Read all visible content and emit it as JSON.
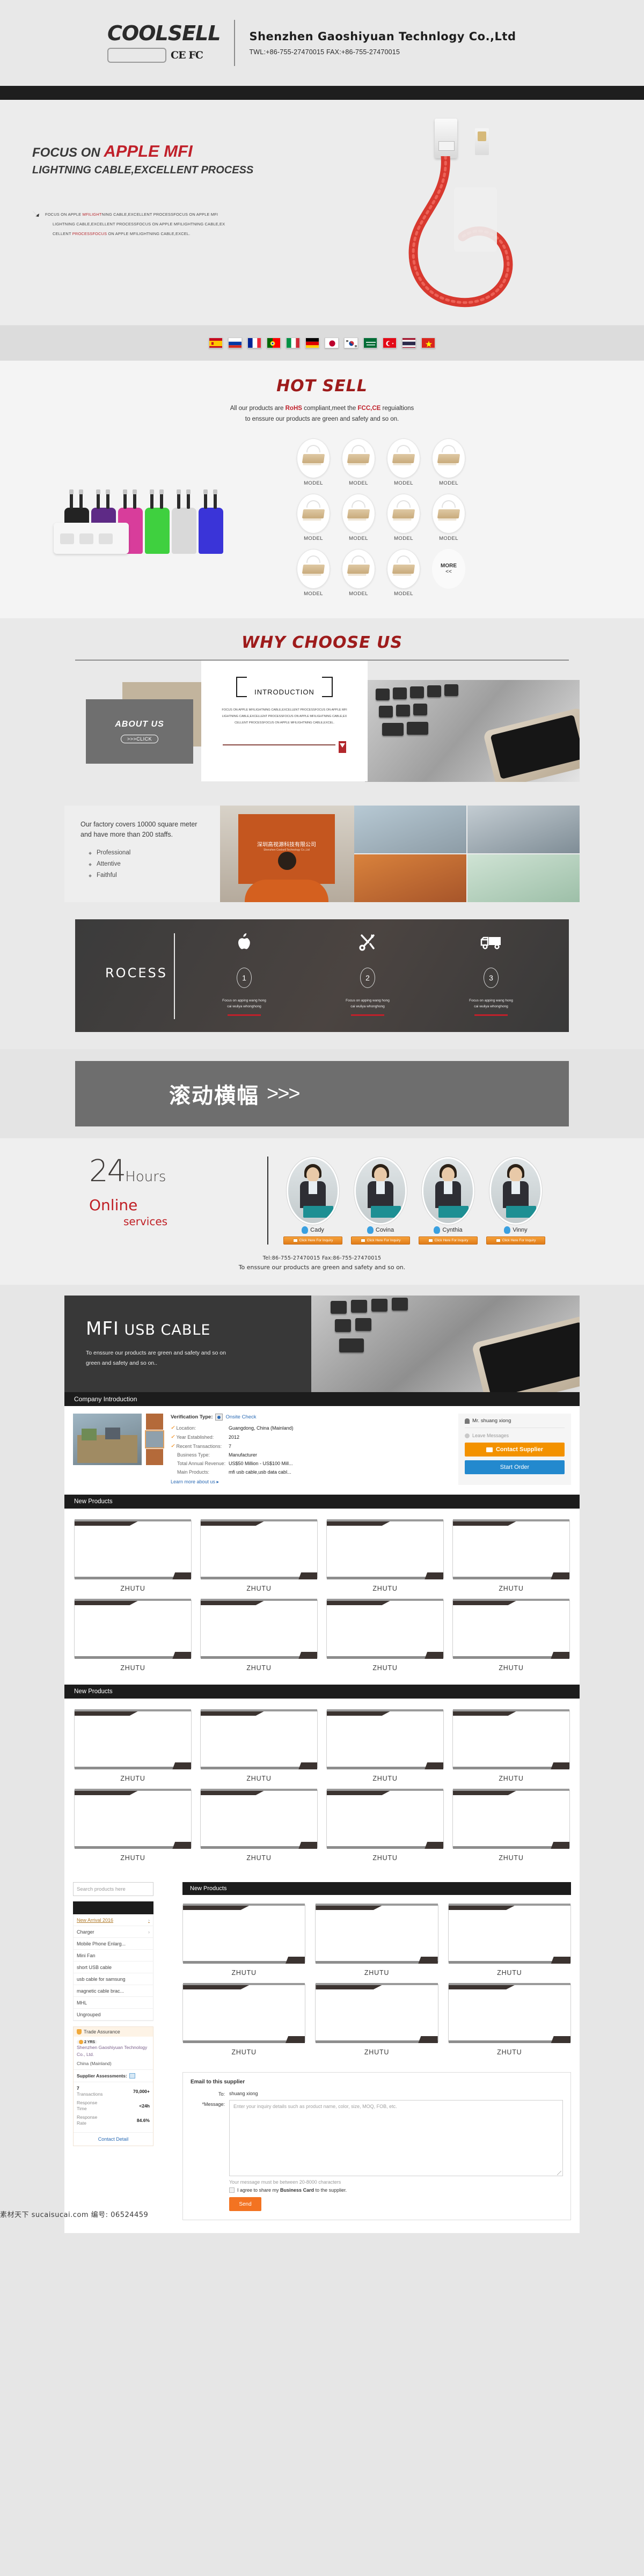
{
  "header": {
    "logo": "COOLSELL",
    "cert_marks": "CE FC",
    "company_name": "Shenzhen Gaoshiyuan Technlogy Co.,Ltd",
    "contact_line": "TWL:+86-755-27470015  FAX:+86-755-27470015"
  },
  "hero": {
    "headline_prefix": "FOCUS ON ",
    "headline_accent": "APPLE MFI",
    "subheadline": "LIGHTNING CABLE,EXCELLENT PROCESS",
    "body_line1_a": "FOCUS ON APPLE ",
    "body_line1_red": "MFILIGHT",
    "body_line1_b": "NING CABLE,EXCELLENT PROCESSFOCUS ON APPLE MFI",
    "body_line2": "LIGHTNING CABLE,EXCELLENT PROCESSFOCUS ON APPLE MFILIGHTNING CABLE,EX",
    "body_line3_a": "CELLENT ",
    "body_line3_red": "PROCESSFOCUS",
    "body_line3_b": " ON APPLE MFILIGHTNING CABLE,EXCEL."
  },
  "flags": [
    {
      "name": "spain"
    },
    {
      "name": "russia"
    },
    {
      "name": "france"
    },
    {
      "name": "portugal"
    },
    {
      "name": "italy"
    },
    {
      "name": "germany"
    },
    {
      "name": "japan"
    },
    {
      "name": "south-korea"
    },
    {
      "name": "saudi-arabia"
    },
    {
      "name": "turkey"
    },
    {
      "name": "thailand"
    },
    {
      "name": "vietnam"
    }
  ],
  "hot_sell": {
    "title": "HOT SELL",
    "sub_a": "All our products are ",
    "sub_rohs": "RoHS",
    "sub_b": " compliant,meet the ",
    "sub_fcc": "FCC,CE",
    "sub_c": " reguialtions",
    "sub_line2": "to enssure our products are green and safety and so on.",
    "models": [
      "MODEL",
      "MODEL",
      "MODEL",
      "MODEL",
      "MODEL",
      "MODEL",
      "MODEL",
      "MODEL",
      "MODEL",
      "MODEL",
      "MODEL"
    ],
    "more_label": "MORE",
    "more_arrow": "<<"
  },
  "why": {
    "title": "WHY CHOOSE US",
    "about_title": "ABOUT US",
    "about_click": ">>>CLICK",
    "introduction_title": "INTRODUCTION",
    "intro_line1": "FOCUS ON APPLE MFILIGHTNING CABLE,EXCELLENT PROCESSFOCUS ON APPLE MFI",
    "intro_line2": "LIGHTNING CABLE,EXCELLENT PROCESSFOCUS ON APPLE MFILIGHTNING CABLE,EX",
    "intro_line3": "CELLENT PROCESSFOCUS ON APPLE MFILIGHTNING CABLE,EXCEL.",
    "factory_text": "Our factory covers 10000 square meter and have more than 200 staffs.",
    "bullets": [
      "Professional",
      "Attentive",
      "Faithful"
    ],
    "reception_cn": "深圳高视源科技有限公司",
    "reception_en": "Shenzhen Coolsell Technology Co.,Ltd"
  },
  "process": {
    "title": "ROCESS",
    "steps": [
      {
        "icon": "apple-icon",
        "number": "1",
        "caption_l1": "Focus on apping wang hong",
        "caption_l2": "cai wuliya whonghong"
      },
      {
        "icon": "tools-icon",
        "number": "2",
        "caption_l1": "Focus on apping wang hong",
        "caption_l2": "cai wuliya whonghong"
      },
      {
        "icon": "truck-icon",
        "number": "3",
        "caption_l1": "Focus on apping wang hong",
        "caption_l2": "cai wuliya whonghong"
      }
    ]
  },
  "scroll_banner": {
    "text": "滚动横幅",
    "arrows": ">>>"
  },
  "hours": {
    "number": "24",
    "hours_word": "Hours",
    "online": "Online",
    "services": "services",
    "staff": [
      {
        "name": "Cady",
        "button": "Click Here For Inquiry"
      },
      {
        "name": "Covina",
        "button": "Click Here For Inquiry"
      },
      {
        "name": "Cynthia",
        "button": "Click Here For Inquiry"
      },
      {
        "name": "Vinny",
        "button": "Click Here For Inquiry"
      }
    ],
    "tel_line": "Tel:86-755-27470015   Fax:86-755-27470015",
    "footer_line": "To enssure our products are green and safety and so on."
  },
  "mfi": {
    "title_bold": "MFI",
    "title_rest": " USB CABLE",
    "desc_l1": "To enssure our products are green and safety and so on",
    "desc_l2": "green and safety and so on.."
  },
  "alibaba": {
    "company_intro_header": "Company Introduction",
    "verification_label": "Verification Type:",
    "verification_value": "Onsite Check",
    "rows": [
      {
        "label": "Location:",
        "value": "Guangdong, China (Mainland)",
        "check": true
      },
      {
        "label": "Year Established:",
        "value": "2012",
        "check": true
      },
      {
        "label": "Recent Transactions:",
        "value": "7",
        "check": true
      },
      {
        "label": "Business Type:",
        "value": "Manufacturer",
        "check": false
      },
      {
        "label": "Total Annual Revenue:",
        "value": "US$50 Million - US$100 Mill...",
        "check": false
      },
      {
        "label": "Main Products:",
        "value": "mfi usb cable,usb data cabl...",
        "check": false
      }
    ],
    "learn_more": "Learn more about us ▸",
    "contact_person": "Mr. shuang xiong",
    "leave_messages": "Leave Messages",
    "contact_supplier": "Contact Supplier",
    "start_order": "Start Order",
    "new_products_header": "New Products"
  },
  "products": {
    "section_headers": [
      "New Products",
      "New Products",
      "New Products"
    ],
    "grid1": [
      "ZHUTU",
      "ZHUTU",
      "ZHUTU",
      "ZHUTU",
      "ZHUTU",
      "ZHUTU",
      "ZHUTU",
      "ZHUTU"
    ],
    "grid2": [
      "ZHUTU",
      "ZHUTU",
      "ZHUTU",
      "ZHUTU",
      "ZHUTU",
      "ZHUTU",
      "ZHUTU",
      "ZHUTU"
    ],
    "grid3": [
      "ZHUTU",
      "ZHUTU",
      "ZHUTU",
      "ZHUTU",
      "ZHUTU",
      "ZHUTU"
    ]
  },
  "sidebar": {
    "search_placeholder": "Search products here",
    "categories": [
      {
        "label": "New Arrival 2016",
        "has_chevron": true
      },
      {
        "label": "Charger",
        "has_chevron": true
      },
      {
        "label": "Mobile Phone Enlarg...",
        "has_chevron": false
      },
      {
        "label": "Mini Fan",
        "has_chevron": false
      },
      {
        "label": "short USB cable",
        "has_chevron": false
      },
      {
        "label": "usb cable for samsung",
        "has_chevron": false
      },
      {
        "label": "magnetic cable brac...",
        "has_chevron": false
      },
      {
        "label": "MHL",
        "has_chevron": false
      },
      {
        "label": "Ungrouped",
        "has_chevron": false
      }
    ],
    "trade_assurance": "Trade Assurance",
    "years_badge": "2 YRS",
    "supplier_name": "Shenzhen Gaoshiyuan Technology Co., Ltd.",
    "supplier_country": "China (Mainland)",
    "assessments_label": "Supplier Assessments:",
    "stats": [
      {
        "label_top": "7",
        "label_bottom": "Transactions",
        "value": "70,000+"
      },
      {
        "label_top": "Response",
        "label_bottom": "Time",
        "value": "<24h"
      },
      {
        "label_top": "Response",
        "label_bottom": "Rate",
        "value": "84.6%"
      }
    ],
    "contact_detail": "Contact Detail"
  },
  "email_form": {
    "title": "Email to this supplier",
    "to_label": "To:",
    "to_value": "shuang xiong",
    "message_label": "*Message:",
    "message_placeholder": "Enter your inquiry details such as product name, color, size, MOQ, FOB, etc.",
    "note": "Your message must be between 20-8000 characters",
    "agree_a": "I agree to share my ",
    "agree_b": "Business Card",
    "agree_c": " to the supplier.",
    "send": "Send"
  },
  "watermark": "素材天下 sucaisucai.com 编号: 06524459",
  "colors": {
    "accent_red": "#c0202a",
    "dark_red": "#9e1b1b",
    "orange": "#f39200",
    "blue": "#2389ce",
    "dark": "#1c1c1c"
  }
}
